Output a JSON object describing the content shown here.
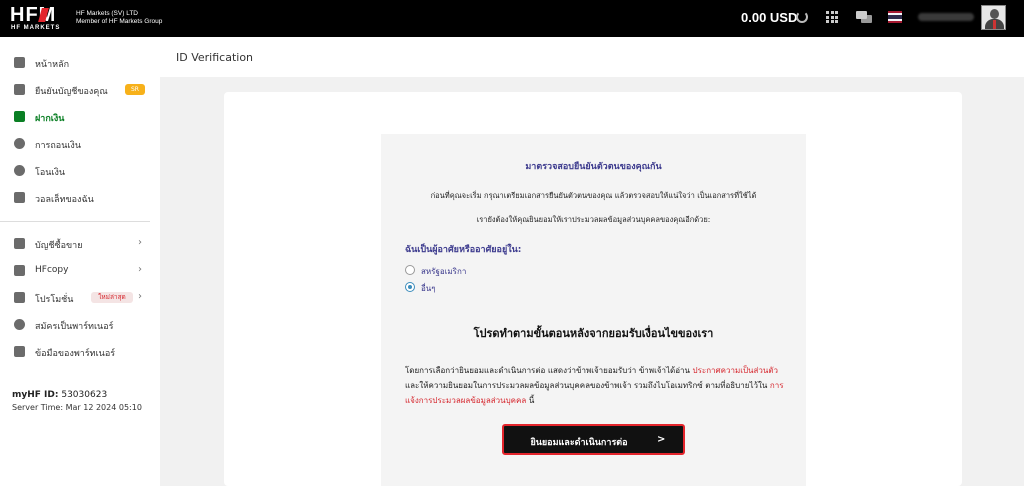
{
  "brand": {
    "logo_text": "HFM",
    "logo_sub": "HF MARKETS",
    "company_line1": "HF Markets (SV) LTD",
    "company_line2": "Member of HF Markets Group"
  },
  "header": {
    "balance": "0.00 USD",
    "icons": [
      "refresh-icon",
      "apps-grid-icon",
      "chat-icon",
      "thailand-flag-icon",
      "avatar"
    ]
  },
  "sidebar": {
    "items": [
      {
        "label": "หน้าหลัก",
        "icon": "chart-icon"
      },
      {
        "label": "ยืนยันบัญชีของคุณ",
        "icon": "document-icon",
        "badge": "SR"
      },
      {
        "label": "ฝากเงิน",
        "icon": "wallet-icon",
        "active": true
      },
      {
        "label": "การถอนเงิน",
        "icon": "withdraw-icon"
      },
      {
        "label": "โอนเงิน",
        "icon": "transfer-icon"
      },
      {
        "label": "วอลเล็ทของฉัน",
        "icon": "wallet-card-icon"
      },
      {
        "label": "บัญชีซื้อขาย",
        "icon": "trading-chart-icon"
      },
      {
        "label": "HFcopy",
        "icon": "layers-icon"
      },
      {
        "label": "โปรโมชั่น",
        "icon": "gift-icon",
        "badge": "ใหม่ล่าสุด"
      },
      {
        "label": "สมัครเป็นพาร์ทเนอร์",
        "icon": "user-icon"
      },
      {
        "label": "ข้อมือของพาร์ทเนอร์",
        "icon": "list-icon"
      }
    ],
    "myhf_label": "myHF ID:",
    "myhf_id": "53030623",
    "server_time": "Server Time: Mar 12 2024 05:10"
  },
  "main": {
    "page_title": "ID Verification",
    "panel_title": "มาตรวจสอบยืนยันตัวตนของคุณกัน",
    "intro_1": "ก่อนที่คุณจะเริ่ม กรุณาเตรียมเอกสารยืนยันตัวตนของคุณ แล้วตรวจสอบให้แน่ใจว่า เป็นเอกสารที่ใช้ได้",
    "intro_2": "เรายังต้องให้คุณยินยอมให้เราประมวลผลข้อมูลส่วนบุคคลของคุณอีกด้วย:",
    "question": "ฉันเป็นผู้อาศัยหรืออาศัยอยู่ใน:",
    "options": [
      {
        "label": "สหรัฐอเมริกา",
        "checked": false
      },
      {
        "label": "อื่นๆ",
        "checked": true
      }
    ],
    "sub_title": "โปรดทำตามขั้นตอนหลังจากยอมรับเงื่อนไขของเรา",
    "consent_part1": "โดยการเลือกว่ายินยอมและดำเนินการต่อ แสดงว่าข้าพเจ้ายอมรับว่า ข้าพเจ้าได้อ่าน ",
    "consent_link1": "ประกาศความเป็นส่วนตัว",
    "consent_part2": " และให้ความยินยอมในการประมวลผลข้อมูลส่วนบุคคลของข้าพเจ้า รวมถึงไบโอเมทริกซ์ ตามที่อธิบายไว้ใน ",
    "consent_link2": "การแจ้งการประมวลผลข้อมูลส่วนบุคคล",
    "consent_part3": " นี้",
    "accept_button": "ยินยอมและดำเนินการต่อ",
    "accept_arrow": ">"
  },
  "colors": {
    "accent_red": "#e4252c",
    "active_green": "#0a7f24",
    "title_navy": "#3d3b8e",
    "link_red": "#d6282f"
  }
}
